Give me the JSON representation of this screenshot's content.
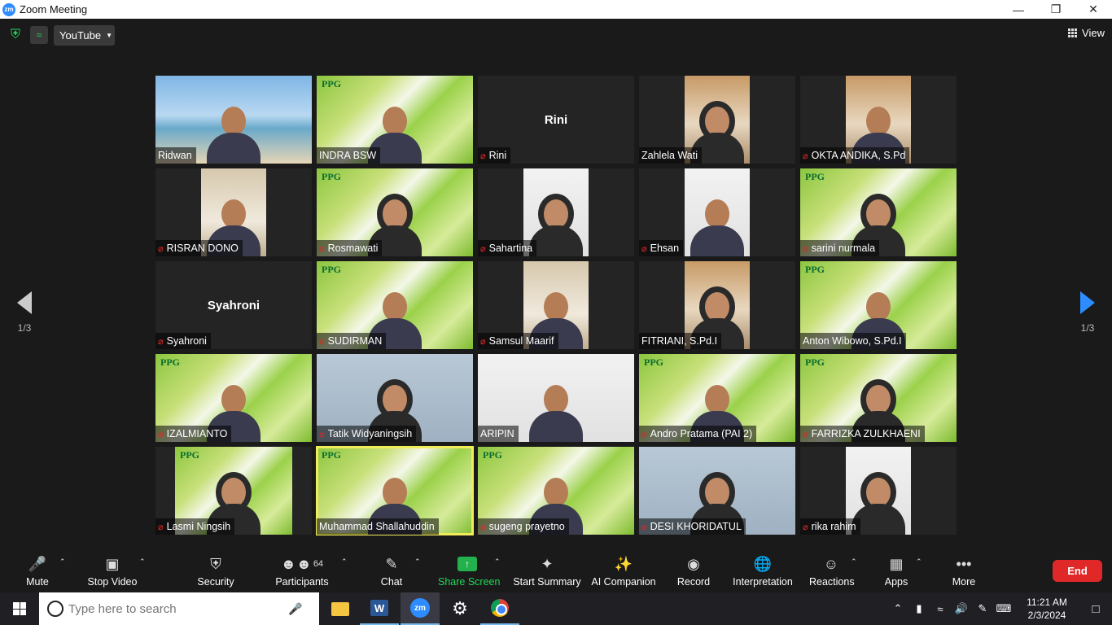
{
  "window": {
    "title": "Zoom Meeting",
    "app_icon": "zm",
    "minimize": "—",
    "maximize": "❐",
    "close": "✕"
  },
  "topbar": {
    "stream_target": "YouTube",
    "view_label": "View"
  },
  "pagination": {
    "left_indicator": "1/3",
    "right_indicator": "1/3"
  },
  "gallery": {
    "tiles": [
      {
        "name": "Ridwan",
        "muted": false,
        "video": "beach"
      },
      {
        "name": "INDRA BSW",
        "muted": false,
        "video": "ppg"
      },
      {
        "name": "Rini",
        "muted": true,
        "video": "none",
        "center_name": "Rini"
      },
      {
        "name": "Zahlela Wati",
        "muted": false,
        "video": "room-inset"
      },
      {
        "name": "OKTA ANDIKA, S.Pd",
        "muted": true,
        "video": "room-inset"
      },
      {
        "name": "RISRAN DONO",
        "muted": true,
        "video": "warm-inset"
      },
      {
        "name": "Rosmawati",
        "muted": true,
        "video": "ppg"
      },
      {
        "name": "Sahartina",
        "muted": true,
        "video": "light-inset"
      },
      {
        "name": "Ehsan",
        "muted": true,
        "video": "light-inset"
      },
      {
        "name": "sarini nurmala",
        "muted": true,
        "video": "ppg"
      },
      {
        "name": "Syahroni",
        "muted": true,
        "video": "none",
        "center_name": "Syahroni"
      },
      {
        "name": "SUDIRMAN",
        "muted": true,
        "video": "ppg"
      },
      {
        "name": "Samsul Maarif",
        "muted": true,
        "video": "warm-inset"
      },
      {
        "name": "FITRIANI, S.Pd.I",
        "muted": false,
        "video": "room-inset"
      },
      {
        "name": "Anton Wibowo, S.Pd.I",
        "muted": false,
        "video": "ppg"
      },
      {
        "name": "IZALMIANTO",
        "muted": true,
        "video": "ppg"
      },
      {
        "name": "Tatik Widyaningsih",
        "muted": true,
        "video": "blue"
      },
      {
        "name": "ARIPIN",
        "muted": false,
        "video": "light"
      },
      {
        "name": "Andro Pratama (PAI 2)",
        "muted": true,
        "video": "ppg"
      },
      {
        "name": "FARRIZKA ZULKHAENI",
        "muted": true,
        "video": "ppg"
      },
      {
        "name": "Lasmi Ningsih",
        "muted": true,
        "video": "ppg-inset"
      },
      {
        "name": "Muhammad Shallahuddin",
        "muted": false,
        "video": "ppg",
        "active_speaker": true
      },
      {
        "name": "sugeng prayetno",
        "muted": true,
        "video": "ppg"
      },
      {
        "name": "DESI KHORIDATUL",
        "muted": true,
        "video": "blue"
      },
      {
        "name": "rika rahim",
        "muted": true,
        "video": "light-inset"
      }
    ],
    "ppg_logo_text": "PPG"
  },
  "toolbar": {
    "mute": "Mute",
    "stop_video": "Stop Video",
    "security": "Security",
    "participants": "Participants",
    "participants_count": "64",
    "chat": "Chat",
    "share_screen": "Share Screen",
    "start_summary": "Start Summary",
    "ai_companion": "AI Companion",
    "record": "Record",
    "interpretation": "Interpretation",
    "reactions": "Reactions",
    "apps": "Apps",
    "more": "More",
    "end": "End"
  },
  "taskbar": {
    "search_placeholder": "Type here to search",
    "clock_time": "11:21 AM",
    "clock_date": "2/3/2024"
  }
}
